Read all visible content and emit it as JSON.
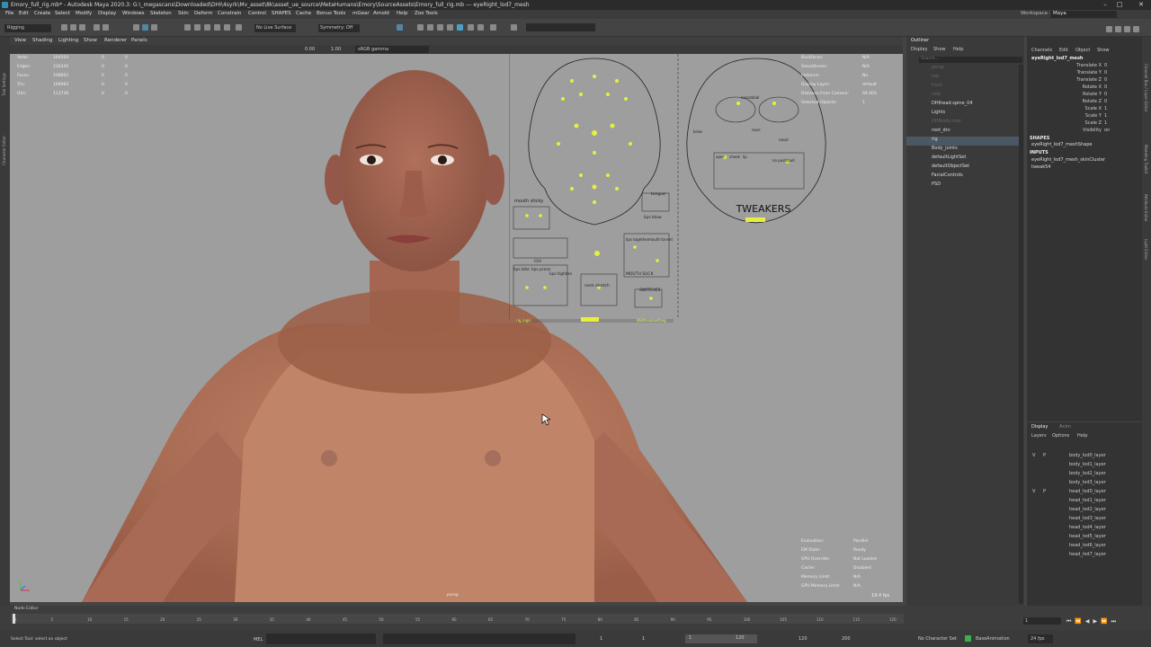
{
  "title": "Emory_full_rig.mb* - Autodesk Maya 2020.3: G:\\_megascans\\Downloaded\\DHI\\4syrk\\Mv_asset\\8k\\asset_ue_source\\MetaHumans\\Emory\\SourceAssets\\Emory_full_rig.mb  ---  eyeRight_lod7_mesh",
  "window_controls": [
    "–",
    "□",
    "✕"
  ],
  "menubar": [
    "File",
    "Edit",
    "Create",
    "Select",
    "Modify",
    "Display",
    "Windows",
    "Skeleton",
    "Skin",
    "Deform",
    "Constrain",
    "Control",
    "SHAPES",
    "Cache",
    "Bonus Tools",
    "mGear",
    "Arnold",
    "Help",
    "Zoo Tools"
  ],
  "workspace": {
    "label": "Workspace :",
    "value": "Maya"
  },
  "status": {
    "mode": "Rigging",
    "live_surface": "No Live Surface",
    "symmetry": "Symmetry: Off"
  },
  "viewport_menu": [
    "View",
    "Shading",
    "Lighting",
    "Show",
    "Renderer",
    "Panels"
  ],
  "viewport_toolbar": {
    "v1": "0.00",
    "v2": "1.00",
    "colorspace": "sRGB gamma"
  },
  "hud_left": [
    {
      "label": "Verts:",
      "a": "169504",
      "b": "0",
      "c": "0"
    },
    {
      "label": "Edges:",
      "a": "216345",
      "b": "0",
      "c": "0"
    },
    {
      "label": "Faces:",
      "a": "108802",
      "b": "0",
      "c": "0"
    },
    {
      "label": "Tris:",
      "a": "168983",
      "b": "0",
      "c": "0"
    },
    {
      "label": "UVs:",
      "a": "113736",
      "b": "0",
      "c": "0"
    }
  ],
  "hud_right_top": [
    {
      "label": "Backfaces:",
      "value": "N/A"
    },
    {
      "label": "Smoothness:",
      "value": "N/A"
    },
    {
      "label": "Instance:",
      "value": "No"
    },
    {
      "label": "Display Layer:",
      "value": "default"
    },
    {
      "label": "Distance From Camera:",
      "value": "94.003"
    },
    {
      "label": "Selected Objects:",
      "value": "1"
    }
  ],
  "hud_right_bottom": [
    {
      "label": "Evaluation:",
      "value": "Parallel"
    },
    {
      "label": "EM State:",
      "value": "Ready"
    },
    {
      "label": "GPU Override:",
      "value": "Not Loaded"
    },
    {
      "label": "Cache:",
      "value": "Disabled"
    },
    {
      "label": "Memory Limit:",
      "value": "N/A"
    },
    {
      "label": "GPU Memory Limit:",
      "value": "N/A"
    }
  ],
  "fps": "19.4 fps",
  "camera": "persp",
  "rig_gui": {
    "tweakers": "TWEAKERS",
    "mouth_sticky": "mouth sticky",
    "tongue": "tongue",
    "lips_blow": "lips blow",
    "chi": "CHI",
    "lips_bite": "lips bite",
    "lips_press": "lips press",
    "lips_tighten": "lips tighten",
    "neck_stretch": "neck stretch",
    "switches": "SWITCHES",
    "lips_together": "lips together",
    "mouth_funnel": "mouth funnel",
    "mouth_suck": "MOUTH SUCK",
    "ctrl_logic": "rig_logic",
    "fix_label": "Widthsubsetting",
    "nasal": "nasolabial",
    "nose_neut": "nose",
    "nasal2": "nasal",
    "open": "open",
    "browL": "brow",
    "cheek": "cheek",
    "noseR": "no push/pull",
    "lip_l": "lip"
  },
  "outliner": {
    "title": "Outliner",
    "menu": [
      "Display",
      "Show",
      "Help"
    ],
    "search": "Search...",
    "items": [
      {
        "label": "persp",
        "dim": true
      },
      {
        "label": "top",
        "dim": true
      },
      {
        "label": "front",
        "dim": true
      },
      {
        "label": "side",
        "dim": true
      },
      {
        "label": "DHIhead:spine_04",
        "dim": false
      },
      {
        "label": "Lights",
        "dim": false
      },
      {
        "label": "DHIbody:root",
        "dim": true
      },
      {
        "label": "root_drv",
        "dim": false
      },
      {
        "label": "rig",
        "dim": false,
        "selected": true
      },
      {
        "label": "Body_joints",
        "dim": false
      },
      {
        "label": "defaultLightSet",
        "dim": false
      },
      {
        "label": "defaultObjectSet",
        "dim": false
      },
      {
        "label": "FacialControls",
        "dim": false
      },
      {
        "label": "PSD",
        "dim": false
      }
    ]
  },
  "channelbox": {
    "menu": [
      "Channels",
      "Edit",
      "Object",
      "Show"
    ],
    "object": "eyeRight_lod7_mesh",
    "attrs": [
      {
        "name": "Translate X",
        "value": "0"
      },
      {
        "name": "Translate Y",
        "value": "0"
      },
      {
        "name": "Translate Z",
        "value": "0"
      },
      {
        "name": "Rotate X",
        "value": "0"
      },
      {
        "name": "Rotate Y",
        "value": "0"
      },
      {
        "name": "Rotate Z",
        "value": "0"
      },
      {
        "name": "Scale X",
        "value": "1"
      },
      {
        "name": "Scale Y",
        "value": "1"
      },
      {
        "name": "Scale Z",
        "value": "1"
      },
      {
        "name": "Visibility",
        "value": "on"
      }
    ],
    "shapes_hdr": "SHAPES",
    "shape": "eyeRight_lod7_meshShape",
    "inputs_hdr": "INPUTS",
    "inputs": [
      "eyeRight_lod7_mesh_skinCluster",
      "tweak54"
    ]
  },
  "layers": {
    "tabs": [
      "Display",
      "Anim"
    ],
    "menu": [
      "Layers",
      "Options",
      "Help"
    ],
    "items": [
      {
        "v": "V",
        "p": "P",
        "name": "body_lod0_layer"
      },
      {
        "v": "",
        "p": "",
        "name": "body_lod1_layer"
      },
      {
        "v": "",
        "p": "",
        "name": "body_lod2_layer"
      },
      {
        "v": "",
        "p": "",
        "name": "body_lod3_layer"
      },
      {
        "v": "V",
        "p": "P",
        "name": "head_lod0_layer"
      },
      {
        "v": "",
        "p": "",
        "name": "head_lod1_layer"
      },
      {
        "v": "",
        "p": "",
        "name": "head_lod2_layer"
      },
      {
        "v": "",
        "p": "",
        "name": "head_lod3_layer"
      },
      {
        "v": "",
        "p": "",
        "name": "head_lod4_layer"
      },
      {
        "v": "",
        "p": "",
        "name": "head_lod5_layer"
      },
      {
        "v": "",
        "p": "",
        "name": "head_lod6_layer"
      },
      {
        "v": "",
        "p": "",
        "name": "head_lod7_layer"
      }
    ]
  },
  "right_strip": [
    "Channel Box / Layer Editor",
    "Modeling Toolkit",
    "Attribute Editor",
    "Light Editor"
  ],
  "left_strip": [
    "Tool Settings",
    "Character Editor"
  ],
  "timeline": {
    "node_editor": "Node Editor",
    "current": "1",
    "ticks": [
      "1",
      "5",
      "10",
      "15",
      "20",
      "25",
      "30",
      "35",
      "40",
      "45",
      "50",
      "55",
      "60",
      "65",
      "70",
      "75",
      "80",
      "85",
      "90",
      "95",
      "100",
      "105",
      "110",
      "115",
      "120"
    ]
  },
  "bottom": {
    "help": "Select Tool: select an object",
    "mel": "MEL",
    "start": "1",
    "start2": "1",
    "range_start": "1",
    "range_end": "120",
    "end": "120",
    "end2": "200",
    "character": "No Character Set",
    "anim_layer": "BaseAnimation",
    "fps": "24 fps"
  },
  "colors": {
    "yellow": "#e6f03c",
    "selected": "#5285a6",
    "skin": "#b47a62"
  }
}
